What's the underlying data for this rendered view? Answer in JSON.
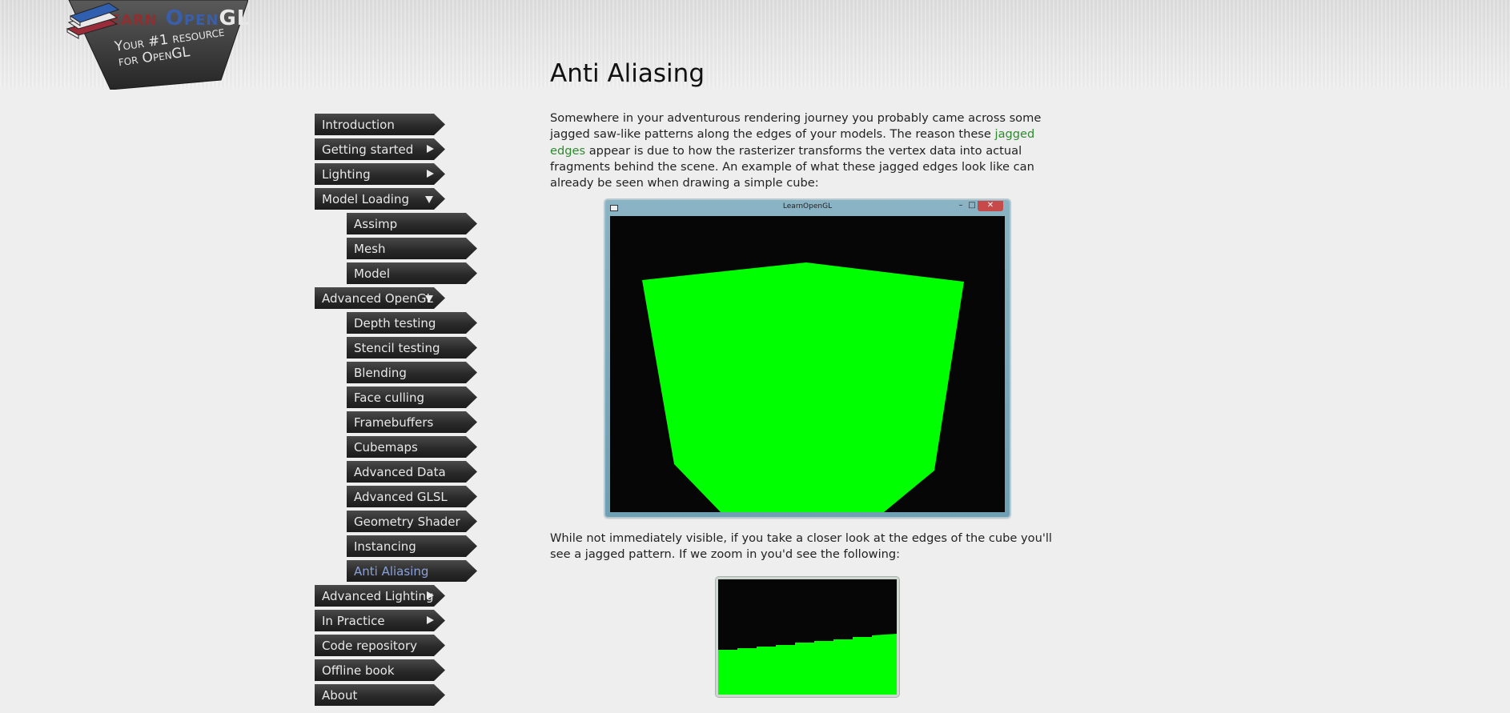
{
  "logo": {
    "title_learn": "Learn",
    "title_open": "Open",
    "title_gl": "GL",
    "tagline_line1": "Your #1 resource",
    "tagline_line2": "for OpenGL"
  },
  "nav": {
    "items": [
      {
        "label": "Introduction",
        "level": 0,
        "arrow": "none"
      },
      {
        "label": "Getting started",
        "level": 0,
        "arrow": "right"
      },
      {
        "label": "Lighting",
        "level": 0,
        "arrow": "right"
      },
      {
        "label": "Model Loading",
        "level": 0,
        "arrow": "down"
      },
      {
        "label": "Assimp",
        "level": 1,
        "arrow": "none"
      },
      {
        "label": "Mesh",
        "level": 1,
        "arrow": "none"
      },
      {
        "label": "Model",
        "level": 1,
        "arrow": "none"
      },
      {
        "label": "Advanced OpenGL",
        "level": 0,
        "arrow": "down"
      },
      {
        "label": "Depth testing",
        "level": 1,
        "arrow": "none"
      },
      {
        "label": "Stencil testing",
        "level": 1,
        "arrow": "none"
      },
      {
        "label": "Blending",
        "level": 1,
        "arrow": "none"
      },
      {
        "label": "Face culling",
        "level": 1,
        "arrow": "none"
      },
      {
        "label": "Framebuffers",
        "level": 1,
        "arrow": "none"
      },
      {
        "label": "Cubemaps",
        "level": 1,
        "arrow": "none"
      },
      {
        "label": "Advanced Data",
        "level": 1,
        "arrow": "none"
      },
      {
        "label": "Advanced GLSL",
        "level": 1,
        "arrow": "none"
      },
      {
        "label": "Geometry Shader",
        "level": 1,
        "arrow": "none"
      },
      {
        "label": "Instancing",
        "level": 1,
        "arrow": "none"
      },
      {
        "label": "Anti Aliasing",
        "level": 1,
        "arrow": "none",
        "active": true
      },
      {
        "label": "Advanced Lighting",
        "level": 0,
        "arrow": "right"
      },
      {
        "label": "In Practice",
        "level": 0,
        "arrow": "right"
      },
      {
        "label": "Code repository",
        "level": 0,
        "arrow": "none"
      },
      {
        "label": "Offline book",
        "level": 0,
        "arrow": "none"
      },
      {
        "label": "About",
        "level": 0,
        "arrow": "none"
      }
    ]
  },
  "content": {
    "title": "Anti Aliasing",
    "para1_before": "Somewhere in your adventurous rendering journey you probably came across some jagged saw-like patterns along the edges of your models. The reason these ",
    "para1_highlight": "jagged edges",
    "para1_after": " appear is due to how the rasterizer transforms the vertex data into actual fragments behind the scene. An example of what these jagged edges look like can already be seen when drawing a simple cube:",
    "window_title": "LearnOpenGL",
    "window_buttons": {
      "minimize": "–",
      "maximize": "□",
      "close": "✕"
    },
    "para2": "While not immediately visible, if you take a closer look at the edges of the cube you'll see a jagged pattern. If we zoom in you'd see the following:"
  },
  "colors": {
    "nav_active": "#8aa0d8",
    "highlight_green": "#2e8a2e",
    "cube_green": "#00ff00",
    "canvas_bg": "#060606"
  }
}
